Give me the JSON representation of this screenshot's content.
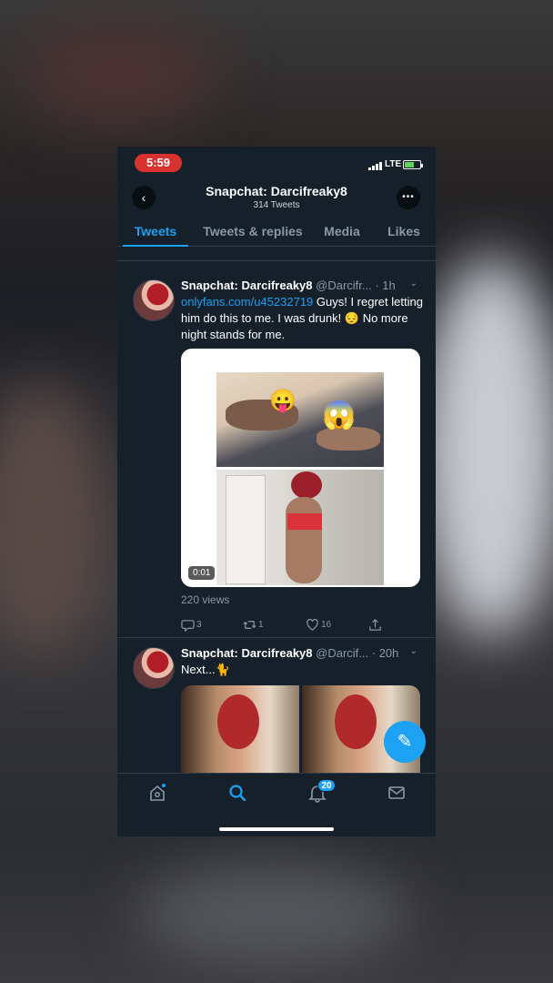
{
  "status_bar": {
    "time": "5:59",
    "network": "LTE"
  },
  "header": {
    "title": "Snapchat: Darcifreaky8",
    "subtitle": "314 Tweets"
  },
  "tabs": [
    {
      "label": "Tweets",
      "active": true
    },
    {
      "label": "Tweets & replies",
      "active": false
    },
    {
      "label": "Media",
      "active": false
    },
    {
      "label": "Likes",
      "active": false
    }
  ],
  "tweets": [
    {
      "name": "Snapchat: Darcifreaky8",
      "handle": "@Darcifr...",
      "time": "· 1h",
      "link": "onlyfans.com/u45232719",
      "text_after_link": " Guys! I regret letting him do this to me. I was drunk! 😔 No more night stands for me.",
      "video_duration": "0:01",
      "views": "220 views",
      "replies": "3",
      "retweets": "1",
      "likes": "16"
    },
    {
      "name": "Snapchat: Darcifreaky8",
      "handle": "@Darcif...",
      "time": "· 20h",
      "text": "Next...🐈"
    }
  ],
  "bottom_nav": {
    "notifications_badge": "20"
  },
  "colors": {
    "accent": "#1da1f2",
    "background": "#15202b",
    "time_pill": "#d8322f"
  }
}
